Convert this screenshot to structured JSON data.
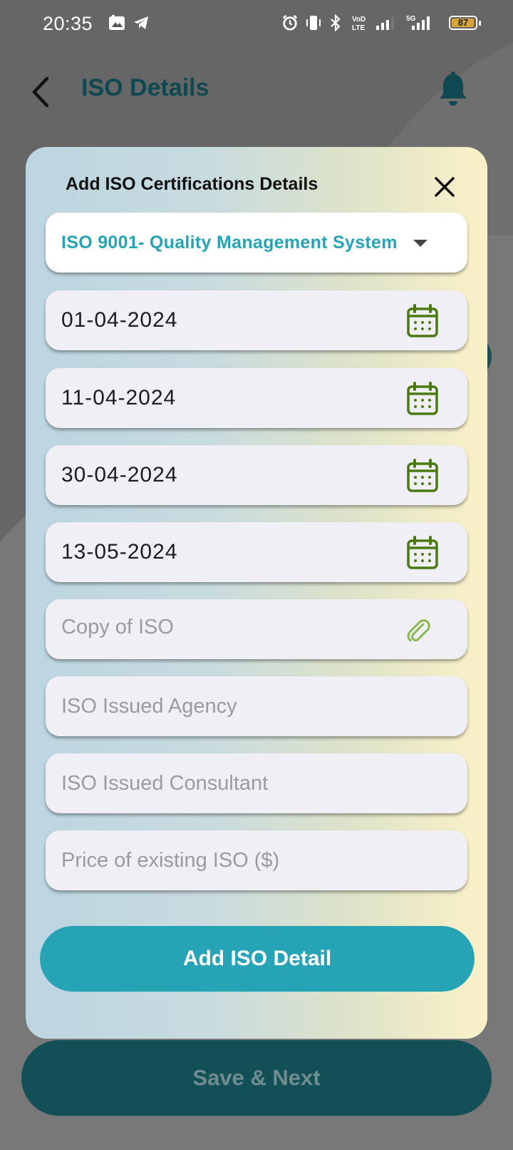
{
  "status_bar": {
    "time": "20:35",
    "battery": "87",
    "network": "5G"
  },
  "app_bar": {
    "title": "ISO Details"
  },
  "dialog": {
    "title": "Add ISO Certifications Details",
    "certification_select": {
      "selected": "ISO 9001- Quality Management System"
    },
    "date_fields": [
      {
        "value": "01-04-2024",
        "icon": "calendar-icon"
      },
      {
        "value": "11-04-2024",
        "icon": "calendar-icon"
      },
      {
        "value": "30-04-2024",
        "icon": "calendar-icon"
      },
      {
        "value": "13-05-2024",
        "icon": "calendar-icon"
      }
    ],
    "copy_field": {
      "placeholder": "Copy of ISO",
      "icon": "paperclip-icon"
    },
    "agency_field": {
      "placeholder": "ISO Issued Agency"
    },
    "consultant_field": {
      "placeholder": "ISO Issued Consultant"
    },
    "price_field": {
      "placeholder": "Price of existing ISO ($)"
    },
    "add_button_label": "Add ISO Detail"
  },
  "footer": {
    "save_next_label": "Save & Next"
  },
  "colors": {
    "accent": "#26a4b6",
    "dark_teal": "#124f57",
    "calendar_icon": "#4a7a12",
    "dropdown_text": "#26a3b4"
  }
}
